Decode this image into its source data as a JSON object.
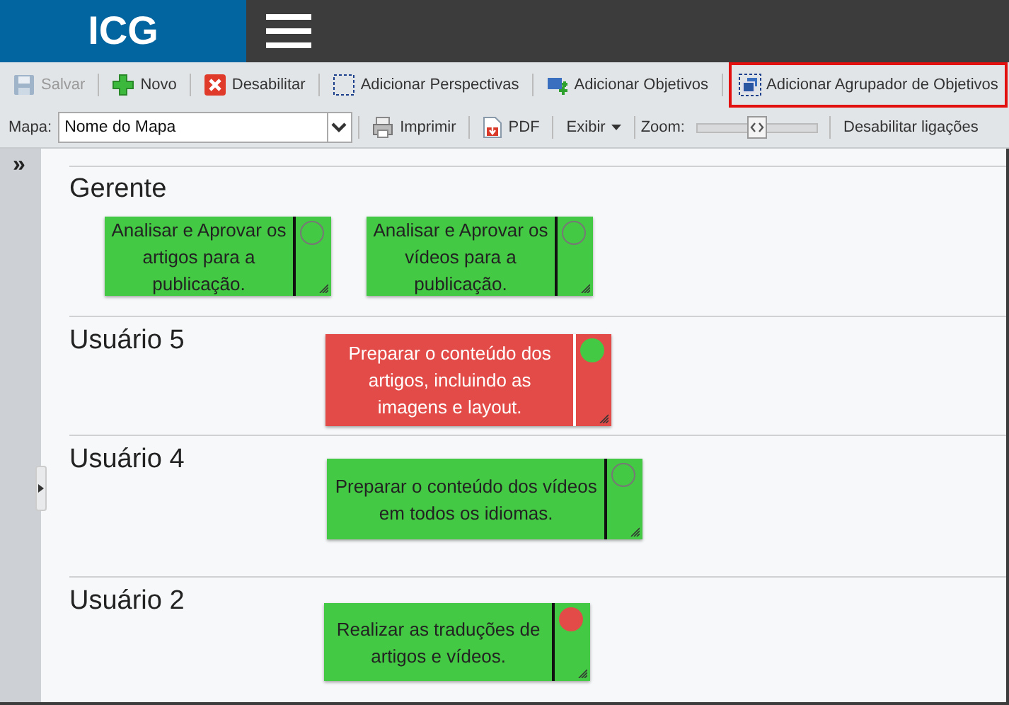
{
  "header": {
    "logo": "ICG"
  },
  "toolbar": [
    {
      "kind": "save",
      "label": "Salvar",
      "disabled": true
    },
    {
      "kind": "new",
      "label": "Novo",
      "disabled": false
    },
    {
      "kind": "disable",
      "label": "Desabilitar",
      "disabled": false
    },
    {
      "kind": "perspective",
      "label": "Adicionar Perspectivas",
      "disabled": false
    },
    {
      "kind": "objective",
      "label": "Adicionar Objetivos",
      "disabled": false
    },
    {
      "kind": "group",
      "label": "Adicionar Agrupador de Objetivos",
      "disabled": false,
      "highlighted": true
    }
  ],
  "map_bar": {
    "map_label": "Mapa:",
    "map_value": "Nome do Mapa",
    "print": "Imprimir",
    "pdf": "PDF",
    "view": "Exibir",
    "zoom_label": "Zoom:",
    "zoom": {
      "level": 0.5
    },
    "disable_links": "Desabilitar ligações"
  },
  "sidebar": {
    "toggle": "»"
  },
  "lanes": [
    {
      "name": "Gerente",
      "cards": [
        {
          "text": "Analisar e Aprovar os artigos para a publicação.",
          "color": "#44c944",
          "dot": {
            "filled": false
          }
        },
        {
          "text": "Analisar e Aprovar os vídeos para a publicação.",
          "color": "#44c944",
          "dot": {
            "filled": false
          }
        }
      ]
    },
    {
      "name": "Usuário 5",
      "cards": [
        {
          "text": "Preparar o conteúdo dos artigos, incluindo as imagens e layout.",
          "color": "#e24b47",
          "dot": {
            "filled": true,
            "color": "#44c944"
          }
        }
      ]
    },
    {
      "name": "Usuário 4",
      "cards": [
        {
          "text": "Preparar o conteúdo dos vídeos em todos os idiomas.",
          "color": "#44c944",
          "dot": {
            "filled": false
          }
        }
      ]
    },
    {
      "name": "Usuário 2",
      "cards": [
        {
          "text": "Realizar as traduções de artigos e vídeos.",
          "color": "#44c944",
          "dot": {
            "filled": true,
            "color": "#e24b47"
          }
        }
      ]
    }
  ]
}
